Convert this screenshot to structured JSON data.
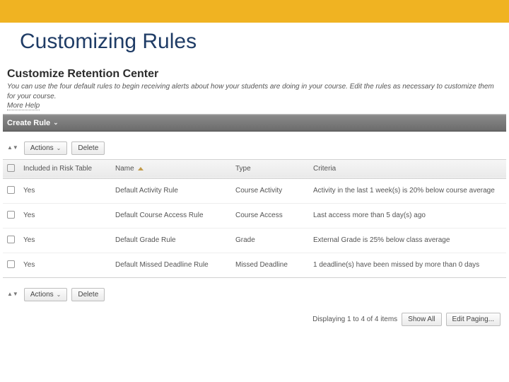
{
  "slide_title": "Customizing Rules",
  "panel": {
    "title": "Customize Retention Center",
    "desc": "You can use the four default rules to begin receiving alerts about how your students are doing in your course. Edit the rules as necessary to customize them for your course.",
    "more_help": "More Help"
  },
  "create_rule_label": "Create Rule",
  "toolbar": {
    "actions_label": "Actions",
    "delete_label": "Delete"
  },
  "columns": {
    "included": "Included in Risk Table",
    "name": "Name",
    "type": "Type",
    "criteria": "Criteria"
  },
  "rows": [
    {
      "included": "Yes",
      "name": "Default Activity Rule",
      "type": "Course Activity",
      "criteria": "Activity in the last 1 week(s) is 20% below course average"
    },
    {
      "included": "Yes",
      "name": "Default Course Access Rule",
      "type": "Course Access",
      "criteria": "Last access more than 5 day(s) ago"
    },
    {
      "included": "Yes",
      "name": "Default Grade Rule",
      "type": "Grade",
      "criteria": "External Grade is 25% below class average"
    },
    {
      "included": "Yes",
      "name": "Default Missed Deadline Rule",
      "type": "Missed Deadline",
      "criteria": "1 deadline(s) have been missed by more than 0 days"
    }
  ],
  "footer": {
    "status": "Displaying 1 to 4 of 4 items",
    "show_all": "Show All",
    "edit_paging": "Edit Paging..."
  }
}
